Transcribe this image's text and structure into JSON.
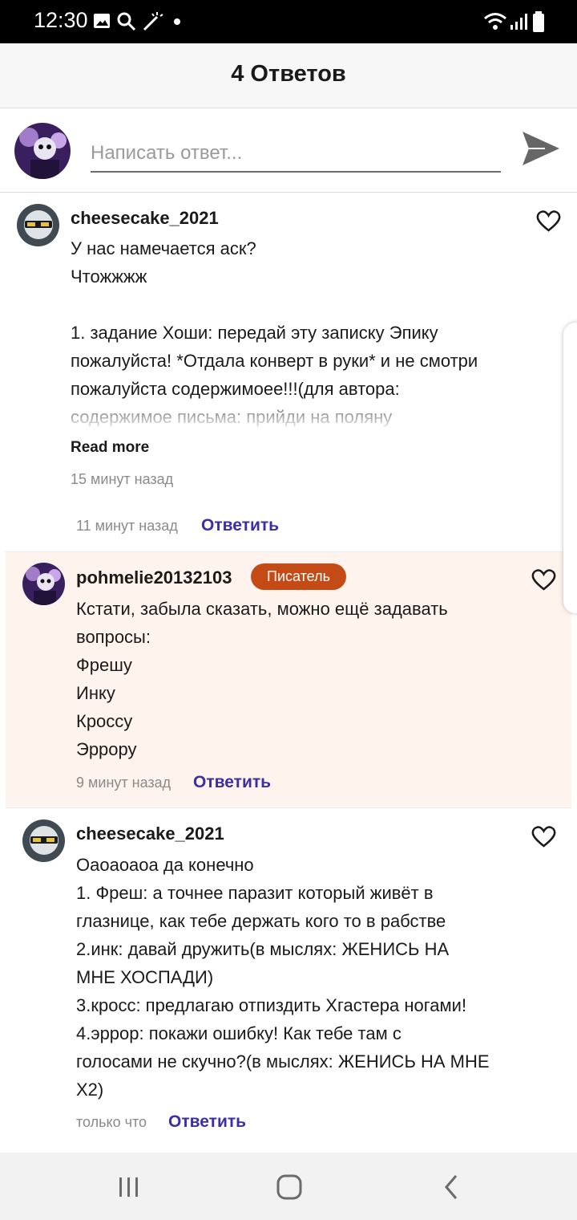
{
  "status": {
    "time": "12:30"
  },
  "header": {
    "title": "4 Ответов"
  },
  "composer": {
    "placeholder": "Написать ответ..."
  },
  "comments": [
    {
      "username": "cheesecake_2021",
      "lines": "У нас намечается аск?\nЧтожжжж\n\n1. задание Хоши: передай эту записку Эпику\nпожалуйста! *Отдала конверт в руки* и не смотри\nпожалуйста содержимоее!!!(для автора:\nсодержимое письма: прийди на поляну",
      "read_more": "Read more",
      "posted": "15 минут назад"
    },
    {
      "time": "11 минут назад",
      "reply": "Ответить"
    },
    {
      "username": "pohmelie20132103",
      "badge": "Писатель",
      "lines": "Кстати, забыла сказать, можно ещё задавать\nвопросы:\nФрешу\nИнку\nКроссу\nЭррору",
      "time": "9 минут назад",
      "reply": "Ответить",
      "highlight_color": "#fff3ee"
    },
    {
      "username": "cheesecake_2021",
      "lines": "Оаоаоаоа да конечно\n1. Фреш: а точнее паразит который живёт в\nглазнице, как тебе держать кого то в рабстве\n2.инк: давай дружить(в мыслях: ЖЕНИСЬ НА\nМНЕ ХОСПАДИ)\n3.кросс: предлагаю отпиздить Хгастера ногами!\n4.эррор: покажи ошибку! Как тебе там с\nголосами не скучно?(в мыслях: ЖЕНИСЬ НА МНЕ\nХ2)",
      "time": "только что",
      "reply": "Ответить"
    }
  ],
  "colors": {
    "accent": "#3b2fa6",
    "badge": "#c44b16",
    "statusbar": "#000000"
  },
  "icons": [
    "image-icon",
    "search-icon",
    "magic-wand-icon",
    "wifi-icon",
    "signal-icon",
    "battery-icon",
    "send-icon",
    "heart-icon",
    "recent-apps-icon",
    "home-icon",
    "back-icon"
  ]
}
